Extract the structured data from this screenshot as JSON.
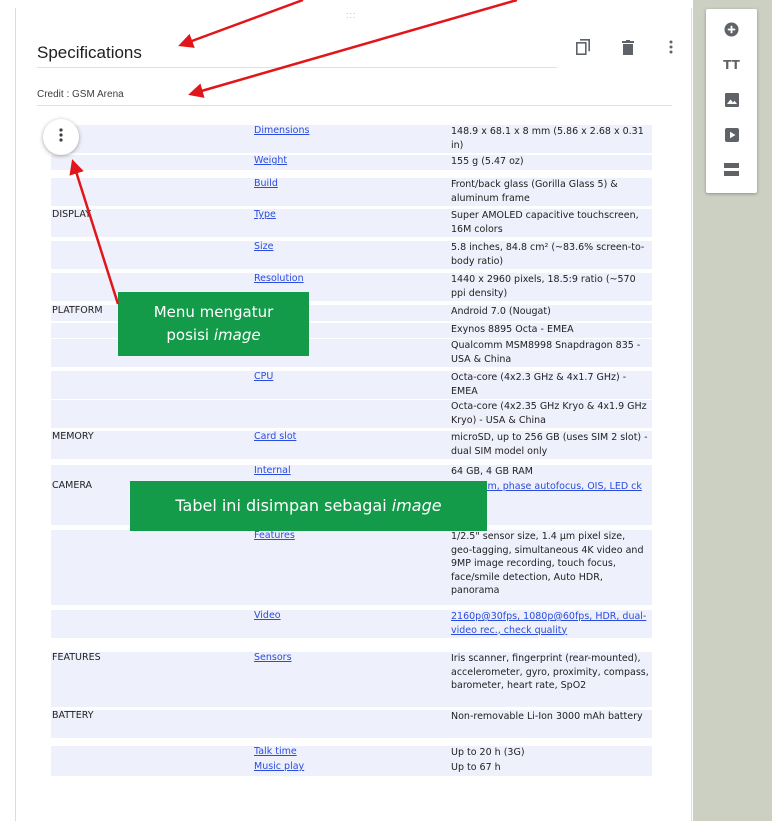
{
  "section": {
    "title": "Specifications",
    "description": "Credit : GSM Arena",
    "drag_handle": ":::"
  },
  "section_tools": [
    "copy-icon",
    "trash-icon",
    "more-vert-icon"
  ],
  "image_menu_icon": "more-vert-icon",
  "side_toolbar": {
    "icons": [
      "add-circle-icon",
      "title-text-icon",
      "image-icon",
      "video-icon",
      "section-icon"
    ],
    "title_icon_text": "TT"
  },
  "spec_table": {
    "rows": [
      {
        "section": "",
        "label": "Dimensions",
        "value": "148.9 x 68.1 x 8 mm (5.86 x 2.68 x 0.31 in)"
      },
      {
        "section": "",
        "label": "Weight",
        "value": "155 g (5.47 oz)"
      },
      {
        "section": "",
        "label": "Build",
        "value": "Front/back glass (Gorilla Glass 5) & aluminum frame"
      },
      {
        "section": "DISPLAY",
        "label": "Type",
        "value": "Super AMOLED capacitive touchscreen, 16M colors"
      },
      {
        "section": "",
        "label": "Size",
        "value": "5.8 inches, 84.8 cm² (~83.6% screen-to-body ratio)"
      },
      {
        "section": "",
        "label": "Resolution",
        "value": "1440 x 2960 pixels, 18.5:9 ratio (~570 ppi density)"
      },
      {
        "section": "PLATFORM",
        "label": "",
        "value": "Android 7.0 (Nougat)"
      },
      {
        "section": "",
        "label": "",
        "value": "Exynos 8895 Octa - EMEA"
      },
      {
        "section": "",
        "label": "",
        "value": "Qualcomm MSM8998 Snapdragon 835 - USA & China"
      },
      {
        "section": "",
        "label": "CPU",
        "value": "Octa-core (4x2.3 GHz & 4x1.7 GHz) - EMEA"
      },
      {
        "section": "",
        "label": "",
        "value": "Octa-core (4x2.35 GHz Kryo & 4x1.9 GHz Kryo) - USA & China"
      },
      {
        "section": "MEMORY",
        "label": "Card slot",
        "value": "microSD, up to 256 GB (uses SIM 2 slot) - dual SIM model only"
      },
      {
        "section": "",
        "label": "Internal",
        "value": "64 GB, 4 GB RAM"
      },
      {
        "section": "CAMERA",
        "label": "",
        "value": ".7, 26mm, phase autofocus, OIS, LED ck quality"
      },
      {
        "section": "",
        "label": "Features",
        "value": "1/2.5\" sensor size, 1.4 µm pixel size, geo-tagging, simultaneous 4K video and 9MP image recording, touch focus, face/smile detection, Auto HDR, panorama"
      },
      {
        "section": "",
        "label": "Video",
        "value": "2160p@30fps, 1080p@60fps, HDR, dual-video rec., check quality"
      },
      {
        "section": "FEATURES",
        "label": "Sensors",
        "value": "Iris scanner, fingerprint (rear-mounted), accelerometer, gyro, proximity, compass, barometer, heart rate, SpO2"
      },
      {
        "section": "BATTERY",
        "label": "",
        "value": "Non-removable Li-Ion 3000 mAh battery"
      },
      {
        "section": "",
        "label": "Talk time",
        "value": "Up to 20 h (3G)"
      },
      {
        "section": "",
        "label": "Music play",
        "value": "Up to 67 h"
      }
    ]
  },
  "annotations": {
    "callout_menu_line1": "Menu mengatur",
    "callout_menu_line2_plain": "posisi ",
    "callout_menu_line2_italic": "image",
    "callout_table_plain": "Tabel ini disimpan sebagai ",
    "callout_table_italic": "image",
    "callout_color": "#139b4a",
    "arrow_color": "#e0161b"
  }
}
